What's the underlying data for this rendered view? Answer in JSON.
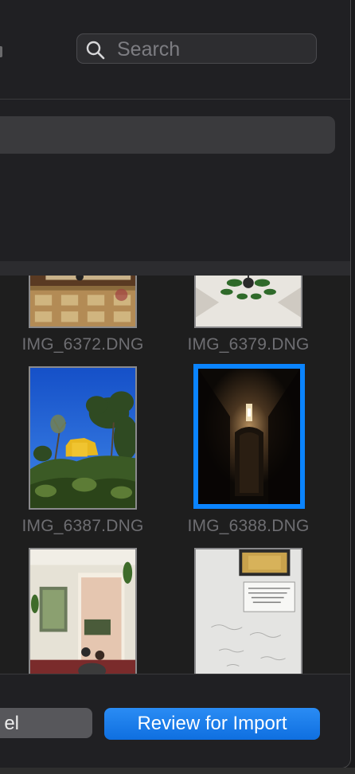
{
  "search": {
    "placeholder": "Search",
    "icon": "search-icon"
  },
  "grid": {
    "items": [
      {
        "filename": "IMG_6372.DNG",
        "selected": false
      },
      {
        "filename": "IMG_6379.DNG",
        "selected": false
      },
      {
        "filename": "IMG_6387.DNG",
        "selected": false
      },
      {
        "filename": "IMG_6388.DNG",
        "selected": true
      },
      {
        "filename": "",
        "selected": false
      },
      {
        "filename": "",
        "selected": false
      }
    ]
  },
  "footer": {
    "cancel_label": "el",
    "import_label": "Review for Import"
  },
  "colors": {
    "accent": "#0a84ff",
    "window_bg": "#202023",
    "grid_bg": "#1e1e1e"
  }
}
